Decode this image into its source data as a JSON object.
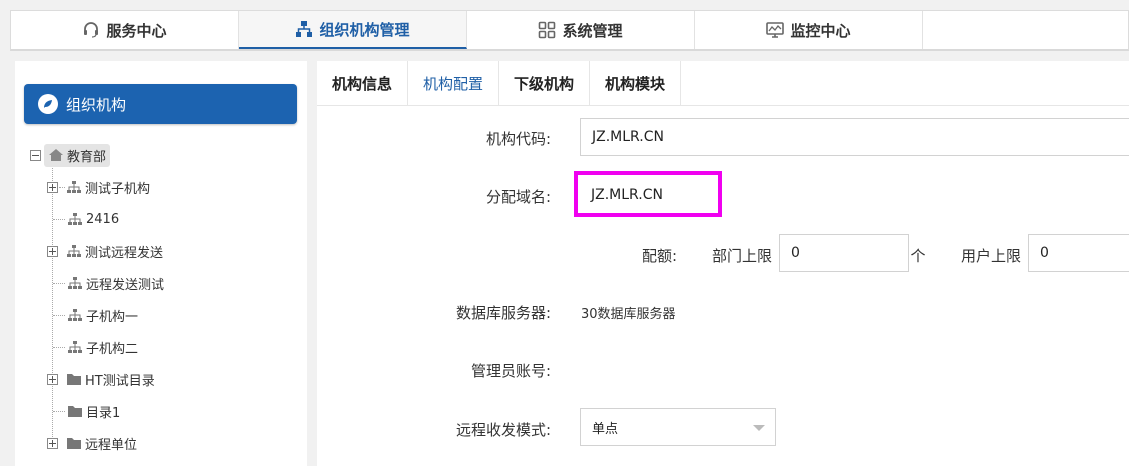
{
  "topnav": {
    "tabs": [
      {
        "label": "服务中心",
        "icon": "headset-icon"
      },
      {
        "label": "组织机构管理",
        "icon": "org-chart-icon",
        "active": true
      },
      {
        "label": "系统管理",
        "icon": "grid-icon"
      },
      {
        "label": "监控中心",
        "icon": "monitor-icon"
      }
    ]
  },
  "sidebar": {
    "header": "组织机构",
    "header_icon": "leaf-icon",
    "root": {
      "label": "教育部",
      "icon": "home-icon"
    },
    "items": [
      {
        "label": "测试子机构",
        "icon": "org-node-icon",
        "expandable": true
      },
      {
        "label": "2416",
        "icon": "org-node-icon",
        "expandable": false
      },
      {
        "label": "测试远程发送",
        "icon": "org-node-icon",
        "expandable": true
      },
      {
        "label": "远程发送测试",
        "icon": "org-node-icon",
        "expandable": false
      },
      {
        "label": "子机构一",
        "icon": "org-node-icon",
        "expandable": false
      },
      {
        "label": "子机构二",
        "icon": "org-node-icon",
        "expandable": false
      },
      {
        "label": "HT测试目录",
        "icon": "folder-icon",
        "expandable": true
      },
      {
        "label": "目录1",
        "icon": "folder-icon",
        "expandable": false
      },
      {
        "label": "远程单位",
        "icon": "folder-icon",
        "expandable": true
      }
    ]
  },
  "subtabs": [
    {
      "label": "机构信息"
    },
    {
      "label": "机构配置",
      "active": true
    },
    {
      "label": "下级机构"
    },
    {
      "label": "机构模块"
    }
  ],
  "form": {
    "org_code_label": "机构代码:",
    "org_code_value": "JZ.MLR.CN",
    "domain_label": "分配域名:",
    "domain_value": "JZ.MLR.CN",
    "quota_label": "配额:",
    "dept_limit_label": "部门上限",
    "dept_limit_value": "0",
    "dept_unit": "个",
    "user_limit_label": "用户上限",
    "user_limit_value": "0",
    "db_server_label": "数据库服务器:",
    "db_server_value": "30数据库服务器",
    "admin_account_label": "管理员账号:",
    "remote_mode_label": "远程收发模式:",
    "remote_mode_value": "单点"
  },
  "colors": {
    "accent": "#1c63b0",
    "highlight": "#f000f0"
  }
}
